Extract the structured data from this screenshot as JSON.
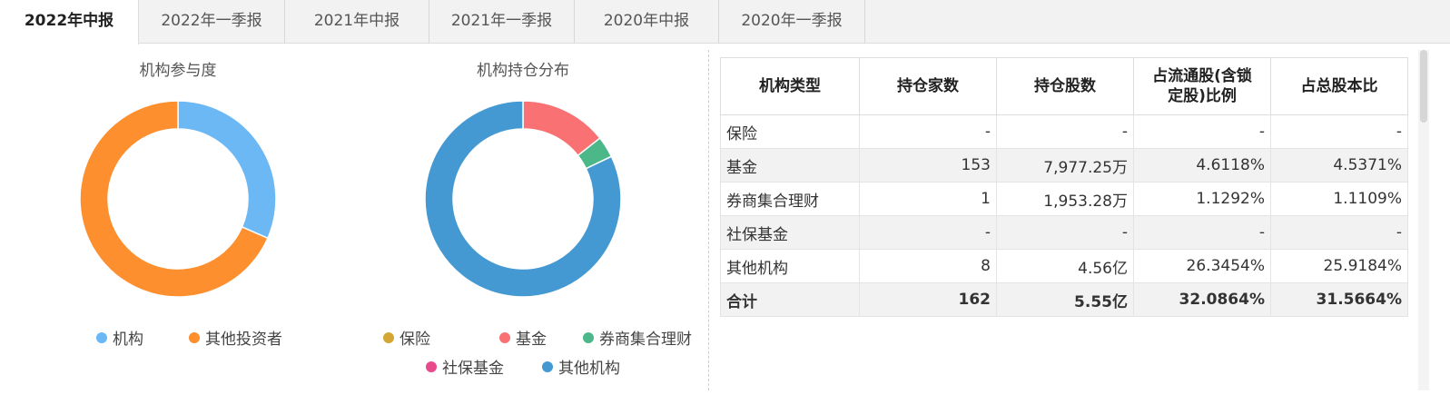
{
  "tabs": [
    {
      "label": "2022年中报",
      "active": true
    },
    {
      "label": "2022年一季报",
      "active": false
    },
    {
      "label": "2021年中报",
      "active": false
    },
    {
      "label": "2021年一季报",
      "active": false
    },
    {
      "label": "2020年中报",
      "active": false
    },
    {
      "label": "2020年一季报",
      "active": false
    }
  ],
  "chart_data": [
    {
      "type": "pie",
      "title": "机构参与度",
      "donut": true,
      "categories": [
        "机构",
        "其他投资者"
      ],
      "values": [
        31.57,
        68.43
      ],
      "colors": [
        "#6cb8f5",
        "#fd8f2e"
      ]
    },
    {
      "type": "pie",
      "title": "机构持仓分布",
      "donut": true,
      "categories": [
        "保险",
        "基金",
        "券商集合理财",
        "社保基金",
        "其他机构"
      ],
      "values": [
        0,
        7977.25,
        1953.28,
        0,
        45600
      ],
      "colors": [
        "#d4a636",
        "#f97172",
        "#4cb88a",
        "#e8498b",
        "#4499d3"
      ]
    }
  ],
  "table": {
    "headers": [
      "机构类型",
      "持仓家数",
      "持仓股数",
      "占流通股(含锁定股)比例",
      "占总股本比"
    ],
    "rows": [
      [
        "保险",
        "-",
        "-",
        "-",
        "-"
      ],
      [
        "基金",
        "153",
        "7,977.25万",
        "4.6118%",
        "4.5371%"
      ],
      [
        "券商集合理财",
        "1",
        "1,953.28万",
        "1.1292%",
        "1.1109%"
      ],
      [
        "社保基金",
        "-",
        "-",
        "-",
        "-"
      ],
      [
        "其他机构",
        "8",
        "4.56亿",
        "26.3454%",
        "25.9184%"
      ],
      [
        "合计",
        "162",
        "5.55亿",
        "32.0864%",
        "31.5664%"
      ]
    ]
  }
}
